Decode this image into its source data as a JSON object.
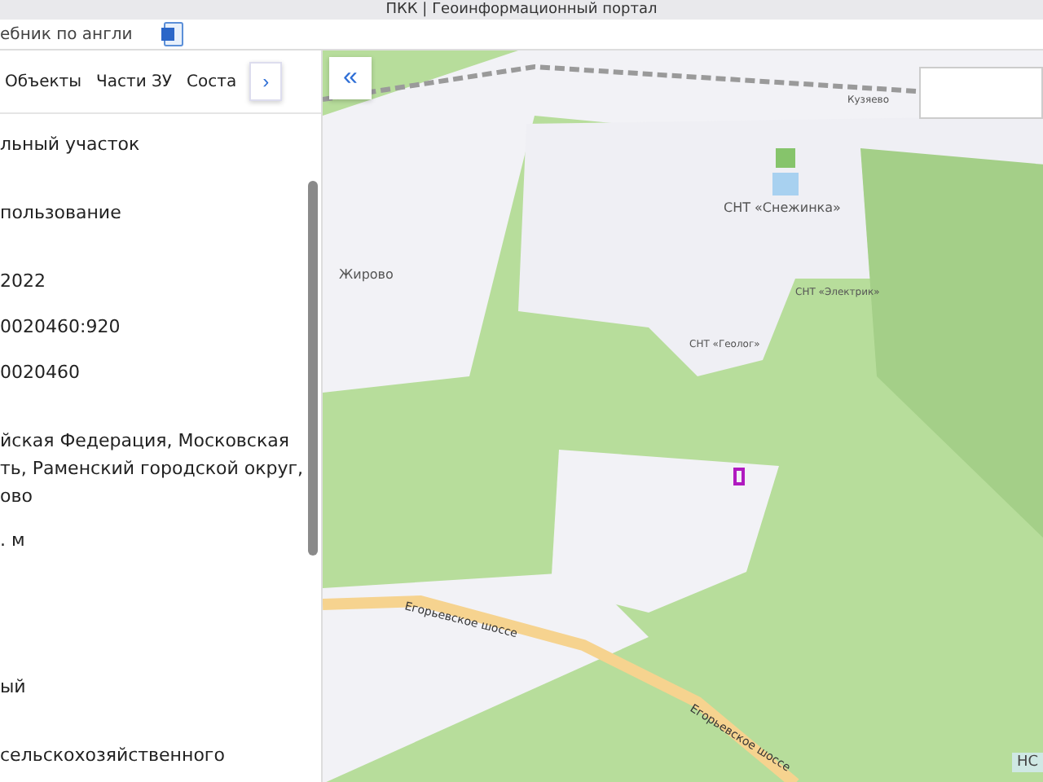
{
  "browser": {
    "tab_title": "ПКК | Геоинформационный портал",
    "bookmark": "ебник по англи"
  },
  "panel": {
    "tabs": [
      {
        "label": "Объекты",
        "selected": false
      },
      {
        "label": "Части ЗУ",
        "selected": false
      },
      {
        "label": "Соста",
        "selected": false
      }
    ],
    "next_button": "›",
    "fields": [
      {
        "lines": [
          "льный участок"
        ]
      },
      {
        "lines": [
          "пользование"
        ]
      },
      {
        "lines": [
          "2022"
        ]
      },
      {
        "lines": [
          "0020460:920"
        ]
      },
      {
        "lines": [
          "0020460"
        ]
      },
      {
        "lines": [
          "йская Федерация, Московская",
          "ть, Раменский городской округ,",
          "ово"
        ]
      },
      {
        "lines": [
          ". м"
        ]
      },
      {
        "lines": [
          "ый"
        ]
      },
      {
        "lines": [
          "сельскохозяйственного"
        ]
      }
    ]
  },
  "map": {
    "collapse_button": "«",
    "labels": [
      {
        "text": "Кузяево",
        "kind": "small"
      },
      {
        "text": "СНТ «Снежинка»",
        "kind": "normal"
      },
      {
        "text": "Жирово",
        "kind": "normal"
      },
      {
        "text": "СНТ «Электрик»",
        "kind": "small"
      },
      {
        "text": "СНТ «Геолог»",
        "kind": "small"
      },
      {
        "text": "Егорьевское шоссе",
        "kind": "road"
      },
      {
        "text": "Егорьевское шоссе",
        "kind": "road"
      }
    ],
    "corner_badge": "НС"
  }
}
